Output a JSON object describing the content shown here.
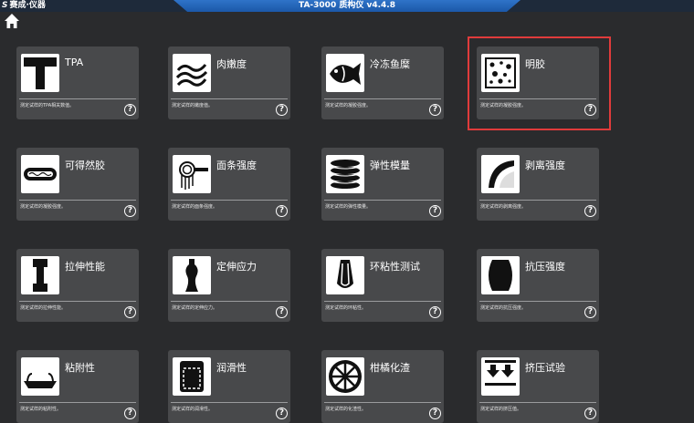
{
  "app": {
    "brand_logo": "S",
    "brand": "赛成·仪器",
    "title": "TA-3000 质构仪    v4.4.8"
  },
  "tiles": [
    {
      "name": "TPA",
      "desc": "测定试样的TPA相关数值。",
      "icon": "t-letter-icon"
    },
    {
      "name": "肉嫩度",
      "desc": "测定试样的嫩度值。",
      "icon": "bacon-icon"
    },
    {
      "name": "冷冻鱼糜",
      "desc": "测定试样的凝胶强度。",
      "icon": "fish-icon"
    },
    {
      "name": "明胶",
      "desc": "测定试样的凝胶强度。",
      "icon": "gelatin-icon"
    },
    {
      "name": "可得然胶",
      "desc": "测定试样的凝胶强度。",
      "icon": "hotdog-icon"
    },
    {
      "name": "面条强度",
      "desc": "测定试样的面条强度。",
      "icon": "noodle-fork-icon"
    },
    {
      "name": "弹性模量",
      "desc": "测定试样的弹性模量。",
      "icon": "stack-icon"
    },
    {
      "name": "剥离强度",
      "desc": "测定试样的剥离强度。",
      "icon": "peel-icon"
    },
    {
      "name": "拉伸性能",
      "desc": "测定试样的拉伸性能。",
      "icon": "dumbbell-specimen-icon"
    },
    {
      "name": "定伸应力",
      "desc": "测定试样的定伸应力。",
      "icon": "bottle-icon"
    },
    {
      "name": "环粘性测试",
      "desc": "测定试样的环粘性。",
      "icon": "loop-tape-icon"
    },
    {
      "name": "抗压强度",
      "desc": "测定试样的抗压强度。",
      "icon": "barrel-icon"
    },
    {
      "name": "粘附性",
      "desc": "测定试样的粘附性。",
      "icon": "boat-icon"
    },
    {
      "name": "润滑性",
      "desc": "测定试样的润滑性。",
      "icon": "container-icon"
    },
    {
      "name": "柑橘化渣",
      "desc": "测定试样的化渣性。",
      "icon": "orange-slice-icon"
    },
    {
      "name": "挤压试验",
      "desc": "测定试样的挤压值。",
      "icon": "press-arrows-icon"
    }
  ],
  "help_glyph": "?"
}
